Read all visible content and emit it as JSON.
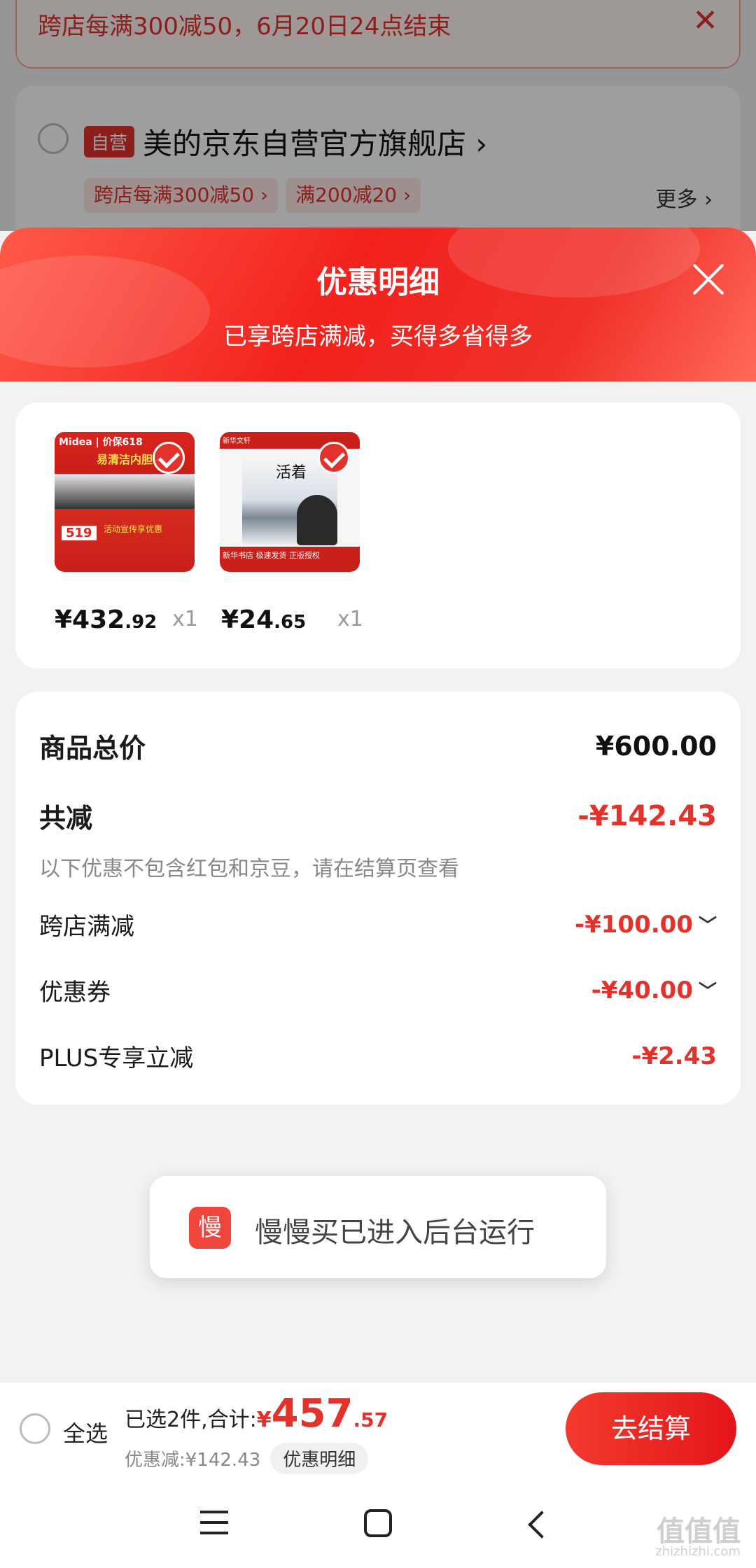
{
  "background_cart": {
    "banner_text": "跨店每满300减50，6月20日24点结束",
    "self_operated_tag": "自营",
    "shop_name": "美的京东自营官方旗舰店 ›",
    "tags": [
      "跨店每满300减50 ›",
      "满200减20 ›"
    ],
    "more_label": "更多 ›"
  },
  "sheet": {
    "title": "优惠明细",
    "subtitle": "已享跨店满减，买得多省得多"
  },
  "products": [
    {
      "image_labels": {
        "brand": "Midea | 价保618",
        "headline": "易清洁内胆",
        "price_tag": "519",
        "promo": "活动宣传享优惠"
      },
      "price_int": "¥432",
      "price_dec": ".92",
      "qty": "x1"
    },
    {
      "image_labels": {
        "top": "新华文轩",
        "title": "活着",
        "band": "新华书店 极速发货 正版授权"
      },
      "price_int": "¥24",
      "price_dec": ".65",
      "qty": "x1"
    }
  ],
  "summary": {
    "goods_total_label": "商品总价",
    "goods_total_value": "¥600.00",
    "total_discount_label": "共减",
    "total_discount_value": "-¥142.43",
    "note": "以下优惠不包含红包和京豆，请在结算页查看",
    "items": [
      {
        "label": "跨店满减",
        "value": "-¥100.00",
        "expandable": true
      },
      {
        "label": "优惠券",
        "value": "-¥40.00",
        "expandable": true
      },
      {
        "label": "PLUS专享立减",
        "value": "-¥2.43",
        "expandable": false
      }
    ]
  },
  "toast": {
    "icon_char": "慢",
    "text": "慢慢买已进入后台运行"
  },
  "bottom_bar": {
    "select_all": "全选",
    "selected_prefix": "已选2件,合计:",
    "total_symbol": "¥",
    "total_int": "457",
    "total_dec": ".57",
    "discount_text": "优惠减:¥142.43",
    "detail_label": "优惠明细",
    "checkout_label": "去结算"
  },
  "watermark": {
    "main": "值值值",
    "sub": "zhizhizhi.com"
  },
  "colors": {
    "accent": "#e3312c",
    "header_red": "#f2211c"
  },
  "icons": [
    "close-icon",
    "check-icon",
    "caret-down-icon",
    "menu-icon",
    "home-icon",
    "back-icon"
  ]
}
